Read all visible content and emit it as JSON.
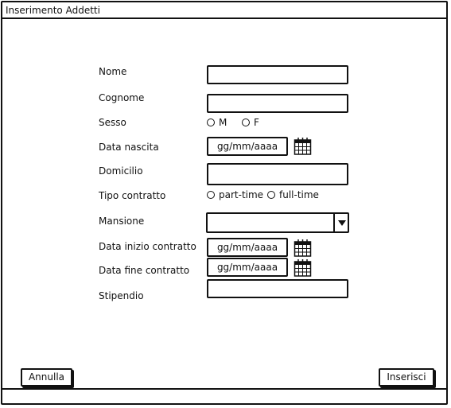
{
  "window": {
    "title": "Inserimento Addetti"
  },
  "form": {
    "nome_label": "Nome",
    "cognome_label": "Cognome",
    "sesso_label": "Sesso",
    "sesso_options": [
      "M",
      "F"
    ],
    "data_nascita_label": "Data nascita",
    "data_nascita_value": "gg/mm/aaaa",
    "domicilio_label": "Domicilio",
    "tipo_contratto_label": "Tipo contratto",
    "tipo_contratto_options": [
      "part-time",
      "full-time"
    ],
    "mansione_label": "Mansione",
    "mansione_value": "",
    "data_inizio_label": "Data inizio contratto",
    "data_inizio_value": "gg/mm/aaaa",
    "data_fine_label": "Data fine contratto",
    "data_fine_value": "gg/mm/aaaa",
    "stipendio_label": "Stipendio"
  },
  "actions": {
    "cancel_label": "Annulla",
    "submit_label": "Inserisci"
  },
  "icons": {
    "calendar": "calendar-icon",
    "dropdown": "chevron-down-icon"
  }
}
